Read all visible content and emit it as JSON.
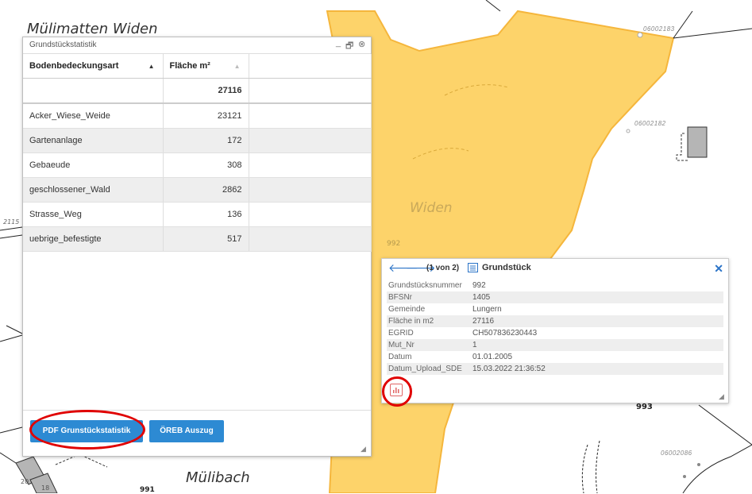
{
  "map": {
    "labels": {
      "muelimatten": "Mülimatten Widen",
      "widen": "Widen",
      "muelibach": "Mülibach",
      "parcel_992": "992",
      "parcel_993": "993",
      "edge_2115": "2115",
      "parcel_20": "20",
      "parcel_18": "18",
      "parcel_991": "991"
    },
    "parcel_ids": {
      "p1": "06002183",
      "p2": "06002182",
      "p3": "06002086"
    },
    "colors": {
      "parcel_fill": "#fdd36a",
      "parcel_stroke": "#f5b63c",
      "building": "#b5b5b5"
    }
  },
  "stat_window": {
    "title": "Grundstückstatistik",
    "controls": {
      "minimize": "_",
      "restore": "🗗",
      "close": "⊗"
    },
    "columns": [
      "Bodenbedeckungsart",
      "Fläche m²"
    ],
    "total": "27116",
    "rows": [
      {
        "type": "Acker_Wiese_Weide",
        "area": "23121"
      },
      {
        "type": "Gartenanlage",
        "area": "172"
      },
      {
        "type": "Gebaeude",
        "area": "308"
      },
      {
        "type": "geschlossener_Wald",
        "area": "2862"
      },
      {
        "type": "Strasse_Weg",
        "area": "136"
      },
      {
        "type": "uebrige_befestigte",
        "area": "517"
      }
    ],
    "buttons": {
      "pdf": "PDF Grunstückstatistik",
      "oereb": "ÖREB Auszug"
    },
    "accent": "#2d8ad3"
  },
  "popup": {
    "counter": "(1 von 2)",
    "title": "Grundstück",
    "fields": [
      {
        "key": "Grundstücksnummer",
        "value": "992"
      },
      {
        "key": "BFSNr",
        "value": "1405"
      },
      {
        "key": "Gemeinde",
        "value": "Lungern"
      },
      {
        "key": "Fläche in m2",
        "value": "27116"
      },
      {
        "key": "EGRID",
        "value": "CH507836230443"
      },
      {
        "key": "Mut_Nr",
        "value": "1"
      },
      {
        "key": "Datum",
        "value": "01.01.2005"
      },
      {
        "key": "Datum_Upload_SDE",
        "value": "15.03.2022 21:36:52"
      }
    ],
    "icons": {
      "prev": "arrow-left-icon",
      "next": "arrow-right-icon",
      "list": "list-icon",
      "close": "close-icon",
      "chart": "bar-chart-icon"
    }
  },
  "highlight_color": "#e00000"
}
